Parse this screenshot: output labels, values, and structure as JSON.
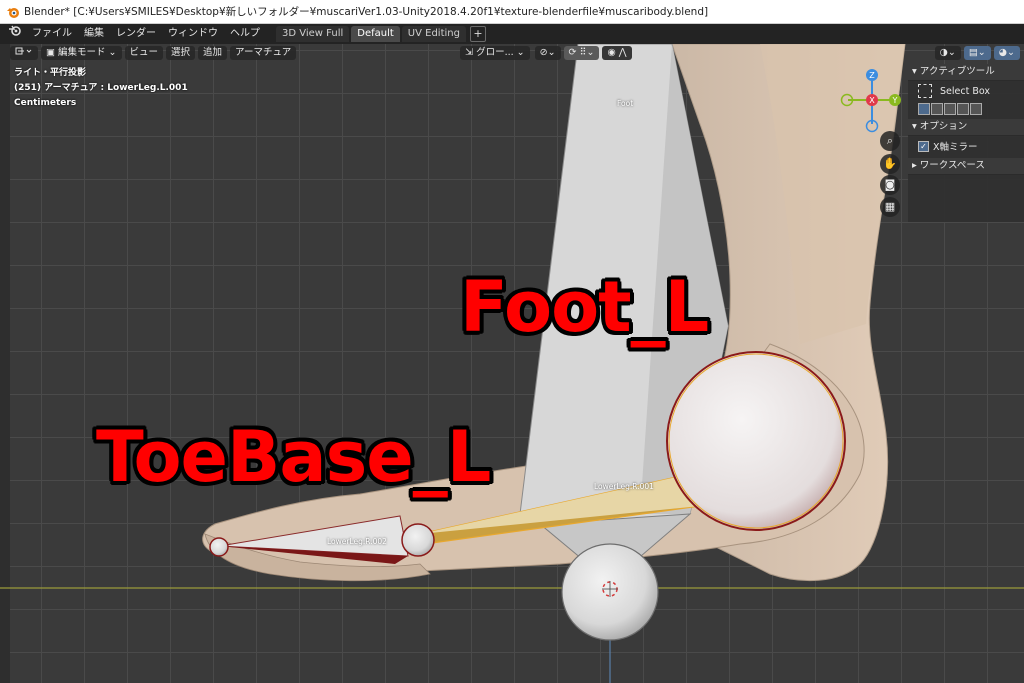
{
  "window": {
    "title": "Blender* [C:¥Users¥SMILES¥Desktop¥新しいフォルダー¥muscariVer1.03-Unity2018.4.20f1¥texture-blenderfile¥muscaribody.blend]"
  },
  "menubar": {
    "items": [
      "ファイル",
      "編集",
      "レンダー",
      "ウィンドウ",
      "ヘルプ"
    ],
    "tabs": [
      "3D View Full",
      "Default",
      "UV Editing"
    ],
    "active_tab": "Default",
    "add_tab": "+"
  },
  "viewport_header": {
    "mode": "編集モード",
    "menus": [
      "ビュー",
      "選択",
      "追加",
      "アーマチュア"
    ],
    "orientation": "グロー..."
  },
  "viewport_info": {
    "view": "ライト・平行投影",
    "object": "(251) アーマチュア : LowerLeg.L.001",
    "units": "Centimeters"
  },
  "sidebar": {
    "active_tool_header": "アクティブツール",
    "tool_name": "Select Box",
    "options_header": "オプション",
    "mirror_label": "X軸ミラー",
    "mirror_checked": true,
    "workspace_header": "ワークスペース"
  },
  "gizmo": {
    "z": "Z",
    "x": "X",
    "y": "Y"
  },
  "bones": {
    "foot": "Foot",
    "lower_leg_001": "LowerLeg.R.001",
    "lower_leg_002": "LowerLeg.R.002"
  },
  "annotations": {
    "foot": "Foot_L",
    "toebase": "ToeBase_L"
  },
  "colors": {
    "annotation": "#ff0000",
    "selection": "#e8a82e",
    "gizmo_x": "#e0394a",
    "gizmo_y": "#8ab91f",
    "gizmo_z": "#3b8de0"
  }
}
